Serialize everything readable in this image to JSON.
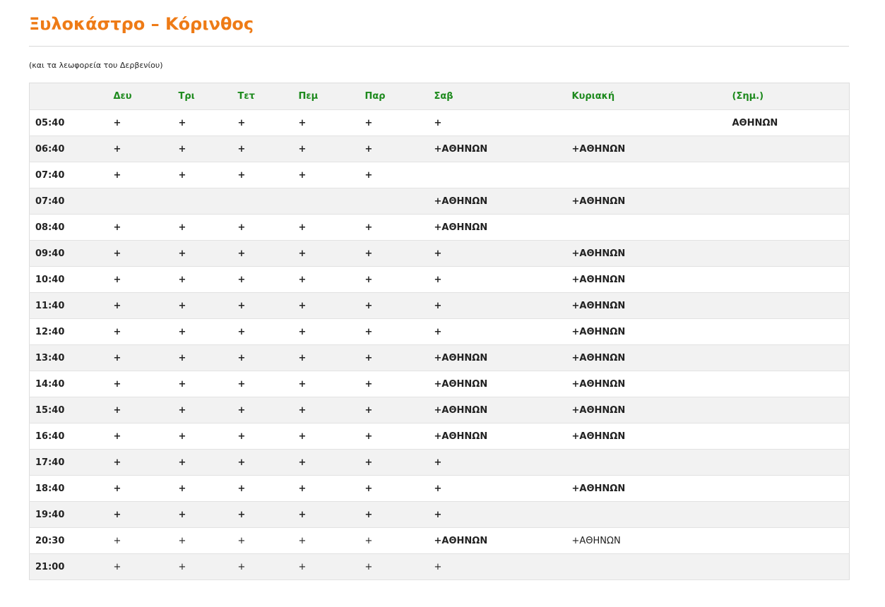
{
  "title": "Ξυλοκάστρο – Κόρινθος",
  "subtitle": "(και τα λεωφορεία του Δερβενίου)",
  "headers": [
    "",
    "Δευ",
    "Τρι",
    "Τετ",
    "Πεμ",
    "Παρ",
    "Σαβ",
    "Κυριακή",
    "(Σημ.)"
  ],
  "rows": [
    [
      "05:40",
      "+",
      "+",
      "+",
      "+",
      "+",
      "+",
      "",
      "ΑΘΗΝΩΝ"
    ],
    [
      "06:40",
      "+",
      "+",
      "+",
      "+",
      "+",
      "+ΑΘΗΝΩΝ",
      "+ΑΘΗΝΩΝ",
      ""
    ],
    [
      "07:40",
      "+",
      "+",
      "+",
      "+",
      "+",
      "",
      "",
      ""
    ],
    [
      "07:40",
      "",
      "",
      "",
      "",
      "",
      "+ΑΘΗΝΩΝ",
      "+ΑΘΗΝΩΝ",
      ""
    ],
    [
      "08:40",
      "+",
      "+",
      "+",
      "+",
      "+",
      "+ΑΘΗΝΩΝ",
      "",
      ""
    ],
    [
      "09:40",
      "+",
      "+",
      "+",
      "+",
      "+",
      "+",
      "+ΑΘΗΝΩΝ",
      ""
    ],
    [
      "10:40",
      "+",
      "+",
      "+",
      "+",
      "+",
      "+",
      "+ΑΘΗΝΩΝ",
      ""
    ],
    [
      "11:40",
      "+",
      "+",
      "+",
      "+",
      "+",
      "+",
      "+ΑΘΗΝΩΝ",
      ""
    ],
    [
      "12:40",
      "+",
      "+",
      "+",
      "+",
      "+",
      "+",
      "+ΑΘΗΝΩΝ",
      ""
    ],
    [
      "13:40",
      "+",
      "+",
      "+",
      "+",
      "+",
      "+ΑΘΗΝΩΝ",
      "+ΑΘΗΝΩΝ",
      ""
    ],
    [
      "14:40",
      "+",
      "+",
      "+",
      "+",
      "+",
      "+ΑΘΗΝΩΝ",
      "+ΑΘΗΝΩΝ",
      ""
    ],
    [
      "15:40",
      "+",
      "+",
      "+",
      "+",
      "+",
      "+ΑΘΗΝΩΝ",
      "+ΑΘΗΝΩΝ",
      ""
    ],
    [
      "16:40",
      "+",
      "+",
      "+",
      "+",
      "+",
      "+ΑΘΗΝΩΝ",
      "+ΑΘΗΝΩΝ",
      ""
    ],
    [
      "17:40",
      "+",
      "+",
      "+",
      "+",
      "+",
      "+",
      "",
      ""
    ],
    [
      "18:40",
      "+",
      "+",
      "+",
      "+",
      "+",
      "+",
      "+ΑΘΗΝΩΝ",
      ""
    ],
    [
      "19:40",
      "+",
      "+",
      "+",
      "+",
      "+",
      "+",
      "",
      ""
    ],
    [
      "20:30",
      "+",
      "+",
      "+",
      "+",
      "+",
      "+ΑΘΗΝΩΝ",
      "+ΑΘΗΝΩΝ",
      ""
    ],
    [
      "21:00",
      "+",
      "+",
      "+",
      "+",
      "+",
      "+",
      "",
      ""
    ]
  ],
  "colors": {
    "title": "#ee7b16",
    "header_text": "#1e8a1e",
    "row_alt": "#f2f2f2"
  }
}
